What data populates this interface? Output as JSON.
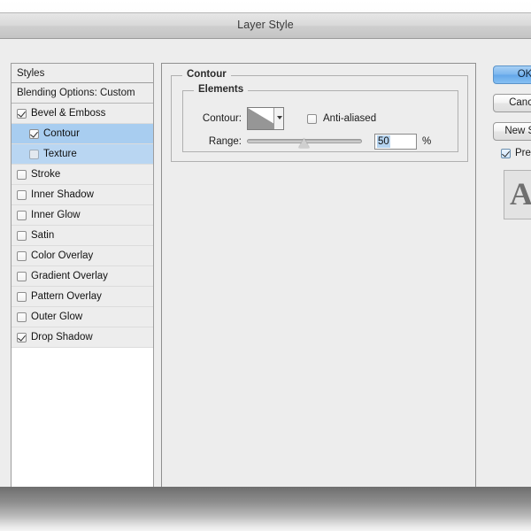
{
  "window": {
    "title": "Layer Style"
  },
  "styles_panel": {
    "header": "Styles",
    "blending_options": "Blending Options: Custom",
    "items": [
      {
        "label": "Bevel & Emboss",
        "checked": true,
        "indent": false,
        "selected": false
      },
      {
        "label": "Contour",
        "checked": true,
        "indent": true,
        "selected": true
      },
      {
        "label": "Texture",
        "checked": false,
        "indent": true,
        "selected": true
      },
      {
        "label": "Stroke",
        "checked": false,
        "indent": false,
        "selected": false
      },
      {
        "label": "Inner Shadow",
        "checked": false,
        "indent": false,
        "selected": false
      },
      {
        "label": "Inner Glow",
        "checked": false,
        "indent": false,
        "selected": false
      },
      {
        "label": "Satin",
        "checked": false,
        "indent": false,
        "selected": false
      },
      {
        "label": "Color Overlay",
        "checked": false,
        "indent": false,
        "selected": false
      },
      {
        "label": "Gradient Overlay",
        "checked": false,
        "indent": false,
        "selected": false
      },
      {
        "label": "Pattern Overlay",
        "checked": false,
        "indent": false,
        "selected": false
      },
      {
        "label": "Outer Glow",
        "checked": false,
        "indent": false,
        "selected": false
      },
      {
        "label": "Drop Shadow",
        "checked": true,
        "indent": false,
        "selected": false
      }
    ]
  },
  "contour_panel": {
    "group_title": "Contour",
    "elements_title": "Elements",
    "contour_label": "Contour:",
    "contour_swatch_icon": "linear-contour-curve",
    "contour_dropdown_icon": "chevron-down-icon",
    "antialiased_label": "Anti-aliased",
    "antialiased_checked": false,
    "range_label": "Range:",
    "range_value": "50",
    "range_unit": "%",
    "range_percent": 50
  },
  "buttons": {
    "ok": "OK",
    "cancel": "Cancel",
    "new_style": "New Style...",
    "preview_label": "Preview",
    "preview_checked": true,
    "preview_thumb_glyph": "A"
  },
  "colors": {
    "selection_blue": "#b9d6f2",
    "selection_blue_strong": "#a8cdf0",
    "default_button_blue": "#7cb6ee",
    "dialog_bg": "#ededed",
    "field_selection": "#b6d4f0"
  }
}
